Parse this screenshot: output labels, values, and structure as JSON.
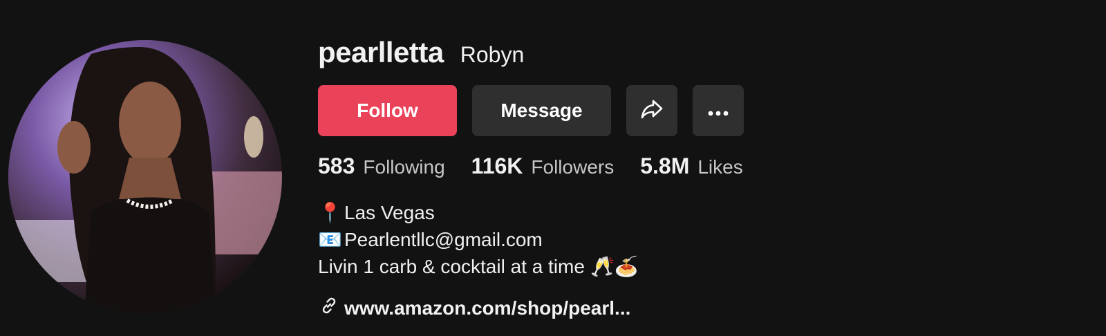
{
  "profile": {
    "username": "pearlletta",
    "nickname": "Robyn"
  },
  "actions": {
    "follow_label": "Follow",
    "message_label": "Message",
    "share_icon": "share-icon",
    "more_icon": "more-icon"
  },
  "stats": [
    {
      "value": "583",
      "label": "Following"
    },
    {
      "value": "116K",
      "label": "Followers"
    },
    {
      "value": "5.8M",
      "label": "Likes"
    }
  ],
  "bio": {
    "location_emoji": "📍",
    "location": "Las Vegas",
    "email_emoji": "📧",
    "email": "Pearlentllc@gmail.com",
    "tagline": "Livin 1 carb & cocktail at a time",
    "tagline_emojis": "🥂🍝"
  },
  "link": {
    "text": "www.amazon.com/shop/pearl...",
    "icon": "link-icon"
  },
  "colors": {
    "background": "#121212",
    "follow_button": "#ea4359",
    "secondary_button": "#2f2f2f",
    "text_primary": "#f1f1f2",
    "text_secondary": "#c6c6c8"
  }
}
